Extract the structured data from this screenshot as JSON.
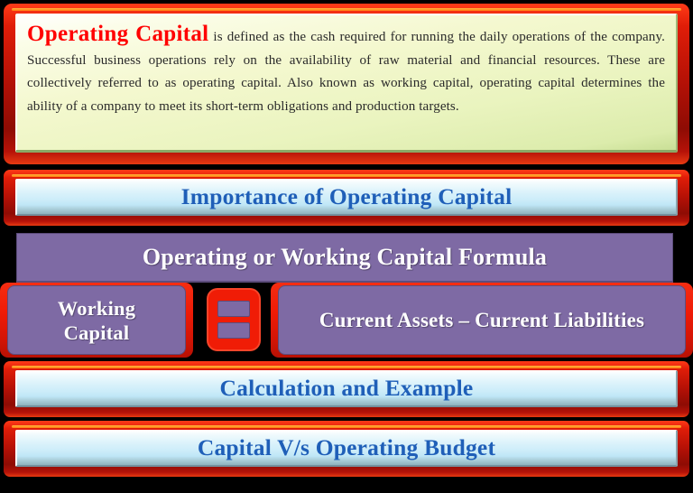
{
  "definition": {
    "lead_term": "Operating  Capital",
    "body": " is defined as the cash required for running the daily operations of the company. Successful business operations rely on the availability of raw material and financial resources. These are collectively referred to as operating capital. Also known as working capital, operating capital determines the ability of a company to meet its short-term obligations and production targets."
  },
  "sections": {
    "importance": "Importance of  Operating Capital",
    "calculation": "Calculation and Example",
    "budget": "Capital  V/s Operating Budget"
  },
  "formula": {
    "header": "Operating or Working Capital Formula",
    "left_term": "Working\nCapital",
    "left_term_line1": "Working",
    "left_term_line2": "Capital",
    "operator": "=",
    "operator_icon": "equals-icon",
    "right_term": "Current Assets – Current Liabilities"
  },
  "colors": {
    "frame_red": "#e01d08",
    "accent_orange": "#ff8c12",
    "heading_blue": "#1f5fb8",
    "purple": "#7e6aa4",
    "purple_border": "#5d4d7c",
    "lead_red": "#ff0000",
    "definition_bg": "#eaf4bf",
    "bar_bg": "#cbecf9",
    "page_bg": "#000000"
  }
}
